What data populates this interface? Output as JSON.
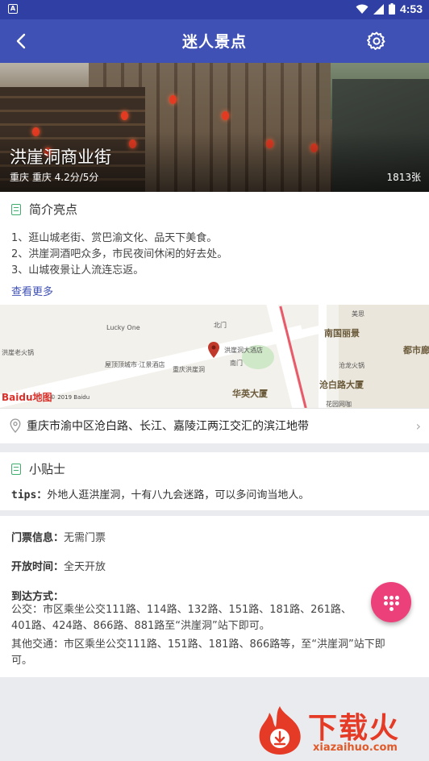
{
  "status": {
    "time": "4:53",
    "left_icon_letter": "A"
  },
  "app_bar": {
    "title": "迷人景点"
  },
  "hero": {
    "name": "洪崖洞商业街",
    "subtitle": "重庆 重庆 4.2分/5分",
    "photo_count": "1813张"
  },
  "intro": {
    "heading": "简介亮点",
    "lines": [
      "1、逛山城老街、赏巴渝文化、品天下美食。",
      "2、洪崖洞酒吧众多，市民夜间休闲的好去处。",
      "3、山城夜景让人流连忘返。"
    ],
    "more_label": "查看更多"
  },
  "map": {
    "labels": [
      "Lucky One",
      "北门",
      "洪崖洞大酒店",
      "南门",
      "屋顶顶城市·江景酒店",
      "重庆洪崖洞",
      "洪崖老火锅",
      "美思",
      "花园网咖",
      "沧龙火锅"
    ],
    "bold_labels": [
      "南国丽景",
      "都市廊",
      "沧白路大厦",
      "华英大厦"
    ],
    "logo_text": "Baidu地图",
    "copyright": "© 2019 Baidu"
  },
  "address": {
    "text": "重庆市渝中区沧白路、长江、嘉陵江两江交汇的滨江地带"
  },
  "tips": {
    "heading": "小贴士",
    "label": "tips：",
    "text": "外地人逛洪崖洞，十有八九会迷路，可以多问询当地人。"
  },
  "info": {
    "ticket_label": "门票信息：",
    "ticket_value": "无需门票",
    "open_label": "开放时间：",
    "open_value": "全天开放",
    "route_label": "到达方式：",
    "bus_line1": "公交：市区乘坐公交111路、114路、132路、151路、181路、261路、",
    "bus_line2": "401路、424路、866路、881路至“洪崖洞”站下即可。",
    "other_line1": "其他交通：市区乘坐公交111路、151路、181路、866路等，至“洪崖洞”站下即",
    "other_line2": "可。"
  },
  "watermark": {
    "big": "下载火",
    "small": "xiazaihuo.com"
  },
  "colors": {
    "app_bar": "#3f51b5",
    "status_bar": "#2f3fa3",
    "accent_green": "#3fae6e",
    "fab": "#ec407a",
    "link": "#3f51b5"
  }
}
